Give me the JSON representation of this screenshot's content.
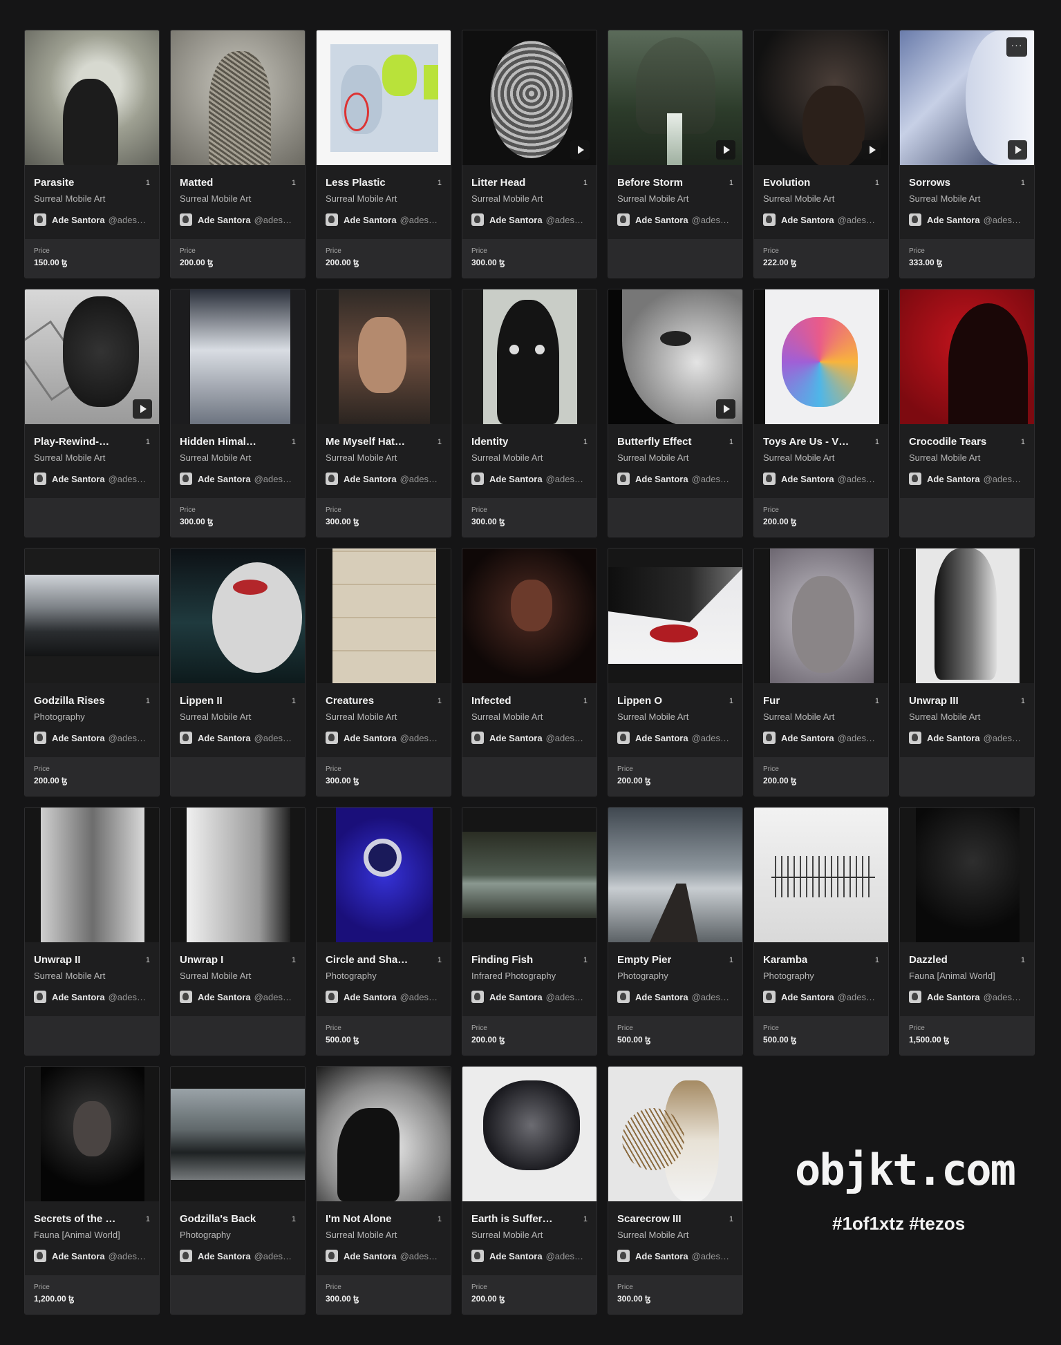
{
  "branding": {
    "logo_text": "objkt.com",
    "hashtags": "#1of1xtz #tezos"
  },
  "cards": [
    {
      "title": "Parasite",
      "edition": "1",
      "category": "Surreal Mobile Art",
      "creator": "Ade Santora",
      "handle": "@adesa…",
      "price_label": "Price",
      "price": "150.00 ꜩ"
    },
    {
      "title": "Matted",
      "edition": "1",
      "category": "Surreal Mobile Art",
      "creator": "Ade Santora",
      "handle": "@adesa…",
      "price_label": "Price",
      "price": "200.00 ꜩ"
    },
    {
      "title": "Less Plastic",
      "edition": "1",
      "category": "Surreal Mobile Art",
      "creator": "Ade Santora",
      "handle": "@adesa…",
      "price_label": "Price",
      "price": "200.00 ꜩ"
    },
    {
      "title": "Litter Head",
      "edition": "1",
      "category": "Surreal Mobile Art",
      "creator": "Ade Santora",
      "handle": "@adesa…",
      "price_label": "Price",
      "price": "300.00 ꜩ"
    },
    {
      "title": "Before Storm",
      "edition": "1",
      "category": "Surreal Mobile Art",
      "creator": "Ade Santora",
      "handle": "@adesa…",
      "price_label": "",
      "price": ""
    },
    {
      "title": "Evolution",
      "edition": "1",
      "category": "Surreal Mobile Art",
      "creator": "Ade Santora",
      "handle": "@adesa…",
      "price_label": "Price",
      "price": "222.00 ꜩ"
    },
    {
      "title": "Sorrows",
      "edition": "1",
      "category": "Surreal Mobile Art",
      "creator": "Ade Santora",
      "handle": "@adesa…",
      "price_label": "Price",
      "price": "333.00 ꜩ",
      "more": "···"
    },
    {
      "title": "Play-Rewind-…",
      "edition": "1",
      "category": "Surreal Mobile Art",
      "creator": "Ade Santora",
      "handle": "@adesa…",
      "price_label": "",
      "price": ""
    },
    {
      "title": "Hidden Himal…",
      "edition": "1",
      "category": "Surreal Mobile Art",
      "creator": "Ade Santora",
      "handle": "@adesa…",
      "price_label": "Price",
      "price": "300.00 ꜩ"
    },
    {
      "title": "Me Myself Hat…",
      "edition": "1",
      "category": "Surreal Mobile Art",
      "creator": "Ade Santora",
      "handle": "@adesa…",
      "price_label": "Price",
      "price": "300.00 ꜩ"
    },
    {
      "title": "Identity",
      "edition": "1",
      "category": "Surreal Mobile Art",
      "creator": "Ade Santora",
      "handle": "@adesa…",
      "price_label": "Price",
      "price": "300.00 ꜩ"
    },
    {
      "title": "Butterfly Effect",
      "edition": "1",
      "category": "Surreal Mobile Art",
      "creator": "Ade Santora",
      "handle": "@adesa…",
      "price_label": "",
      "price": ""
    },
    {
      "title": "Toys Are Us - V…",
      "edition": "1",
      "category": "Surreal Mobile Art",
      "creator": "Ade Santora",
      "handle": "@adesa…",
      "price_label": "Price",
      "price": "200.00 ꜩ"
    },
    {
      "title": "Crocodile Tears",
      "edition": "1",
      "category": "Surreal Mobile Art",
      "creator": "Ade Santora",
      "handle": "@adesa…",
      "price_label": "",
      "price": ""
    },
    {
      "title": "Godzilla Rises",
      "edition": "1",
      "category": "Photography",
      "creator": "Ade Santora",
      "handle": "@adesa…",
      "price_label": "Price",
      "price": "200.00 ꜩ"
    },
    {
      "title": "Lippen II",
      "edition": "1",
      "category": "Surreal Mobile Art",
      "creator": "Ade Santora",
      "handle": "@adesa…",
      "price_label": "",
      "price": ""
    },
    {
      "title": "Creatures",
      "edition": "1",
      "category": "Surreal Mobile Art",
      "creator": "Ade Santora",
      "handle": "@adesa…",
      "price_label": "Price",
      "price": "300.00 ꜩ"
    },
    {
      "title": "Infected",
      "edition": "1",
      "category": "Surreal Mobile Art",
      "creator": "Ade Santora",
      "handle": "@adesa…",
      "price_label": "",
      "price": ""
    },
    {
      "title": "Lippen O",
      "edition": "1",
      "category": "Surreal Mobile Art",
      "creator": "Ade Santora",
      "handle": "@adesa…",
      "price_label": "Price",
      "price": "200.00 ꜩ"
    },
    {
      "title": "Fur",
      "edition": "1",
      "category": "Surreal Mobile Art",
      "creator": "Ade Santora",
      "handle": "@adesa…",
      "price_label": "Price",
      "price": "200.00 ꜩ"
    },
    {
      "title": "Unwrap III",
      "edition": "1",
      "category": "Surreal Mobile Art",
      "creator": "Ade Santora",
      "handle": "@adesa…",
      "price_label": "",
      "price": ""
    },
    {
      "title": "Unwrap II",
      "edition": "1",
      "category": "Surreal Mobile Art",
      "creator": "Ade Santora",
      "handle": "@adesa…",
      "price_label": "",
      "price": ""
    },
    {
      "title": "Unwrap I",
      "edition": "1",
      "category": "Surreal Mobile Art",
      "creator": "Ade Santora",
      "handle": "@adesa…",
      "price_label": "",
      "price": ""
    },
    {
      "title": "Circle and Sha…",
      "edition": "1",
      "category": "Photography",
      "creator": "Ade Santora",
      "handle": "@adesa…",
      "price_label": "Price",
      "price": "500.00 ꜩ"
    },
    {
      "title": "Finding Fish",
      "edition": "1",
      "category": "Infrared Photography",
      "creator": "Ade Santora",
      "handle": "@adesa…",
      "price_label": "Price",
      "price": "200.00 ꜩ"
    },
    {
      "title": "Empty Pier",
      "edition": "1",
      "category": "Photography",
      "creator": "Ade Santora",
      "handle": "@adesa…",
      "price_label": "Price",
      "price": "500.00 ꜩ"
    },
    {
      "title": "Karamba",
      "edition": "1",
      "category": "Photography",
      "creator": "Ade Santora",
      "handle": "@adesa…",
      "price_label": "Price",
      "price": "500.00 ꜩ"
    },
    {
      "title": "Dazzled",
      "edition": "1",
      "category": "Fauna [Animal World]",
      "creator": "Ade Santora",
      "handle": "@adesa…",
      "price_label": "Price",
      "price": "1,500.00 ꜩ"
    },
    {
      "title": "Secrets of the …",
      "edition": "1",
      "category": "Fauna [Animal World]",
      "creator": "Ade Santora",
      "handle": "@adesa…",
      "price_label": "Price",
      "price": "1,200.00 ꜩ"
    },
    {
      "title": "Godzilla's Back",
      "edition": "1",
      "category": "Photography",
      "creator": "Ade Santora",
      "handle": "@adesa…",
      "price_label": "",
      "price": ""
    },
    {
      "title": "I'm Not Alone",
      "edition": "1",
      "category": "Surreal Mobile Art",
      "creator": "Ade Santora",
      "handle": "@adesa…",
      "price_label": "Price",
      "price": "300.00 ꜩ"
    },
    {
      "title": "Earth is Suffer…",
      "edition": "1",
      "category": "Surreal Mobile Art",
      "creator": "Ade Santora",
      "handle": "@adesa…",
      "price_label": "Price",
      "price": "200.00 ꜩ"
    },
    {
      "title": "Scarecrow III",
      "edition": "1",
      "category": "Surreal Mobile Art",
      "creator": "Ade Santora",
      "handle": "@adesa…",
      "price_label": "Price",
      "price": "300.00 ꜩ"
    }
  ]
}
